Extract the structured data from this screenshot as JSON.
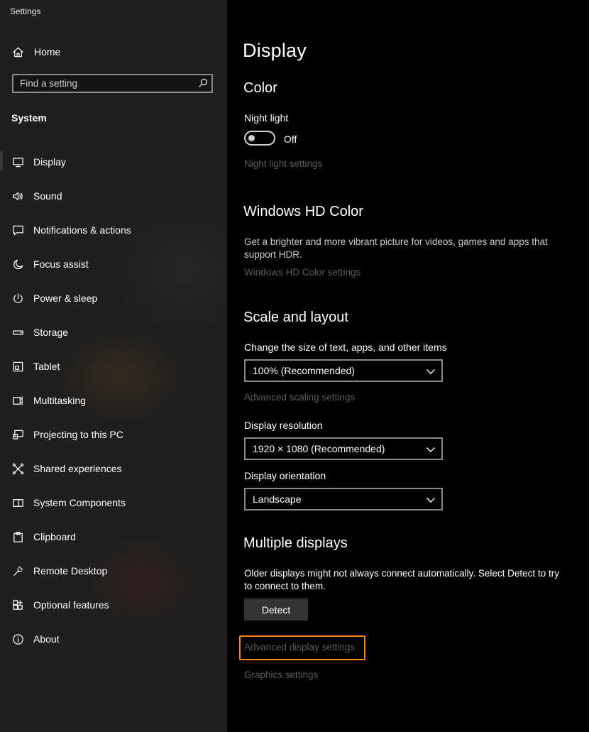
{
  "window": {
    "title": "Settings"
  },
  "sidebar": {
    "home_label": "Home",
    "search_placeholder": "Find a setting",
    "section_label": "System",
    "items": [
      {
        "label": "Display",
        "icon": "monitor-icon",
        "selected": true
      },
      {
        "label": "Sound",
        "icon": "speaker-icon"
      },
      {
        "label": "Notifications & actions",
        "icon": "notification-icon"
      },
      {
        "label": "Focus assist",
        "icon": "moon-icon"
      },
      {
        "label": "Power & sleep",
        "icon": "power-icon"
      },
      {
        "label": "Storage",
        "icon": "storage-icon"
      },
      {
        "label": "Tablet",
        "icon": "tablet-icon"
      },
      {
        "label": "Multitasking",
        "icon": "multitasking-icon"
      },
      {
        "label": "Projecting to this PC",
        "icon": "projecting-icon"
      },
      {
        "label": "Shared experiences",
        "icon": "shared-experiences-icon"
      },
      {
        "label": "System Components",
        "icon": "system-components-icon"
      },
      {
        "label": "Clipboard",
        "icon": "clipboard-icon"
      },
      {
        "label": "Remote Desktop",
        "icon": "remote-desktop-icon"
      },
      {
        "label": "Optional features",
        "icon": "optional-features-icon"
      },
      {
        "label": "About",
        "icon": "info-icon"
      }
    ]
  },
  "main": {
    "title": "Display",
    "color": {
      "heading": "Color",
      "night_light_label": "Night light",
      "night_light_state": "Off",
      "night_light_link": "Night light settings"
    },
    "hdr": {
      "heading": "Windows HD Color",
      "description": "Get a brighter and more vibrant picture for videos, games and apps that support HDR.",
      "link": "Windows HD Color settings"
    },
    "scale": {
      "heading": "Scale and layout",
      "size_label": "Change the size of text, apps, and other items",
      "size_value": "100% (Recommended)",
      "advanced_link": "Advanced scaling settings",
      "resolution_label": "Display resolution",
      "resolution_value": "1920 × 1080 (Recommended)",
      "orientation_label": "Display orientation",
      "orientation_value": "Landscape"
    },
    "multiple": {
      "heading": "Multiple displays",
      "description": "Older displays might not always connect automatically. Select Detect to try to connect to them.",
      "detect_button": "Detect",
      "advanced_display_link": "Advanced display settings",
      "graphics_link": "Graphics settings"
    }
  },
  "colors": {
    "sidebar_bg": "#1f1f1f",
    "main_bg": "#000000",
    "dim_link": "#5c5c5c",
    "highlight": "#f5870d"
  }
}
